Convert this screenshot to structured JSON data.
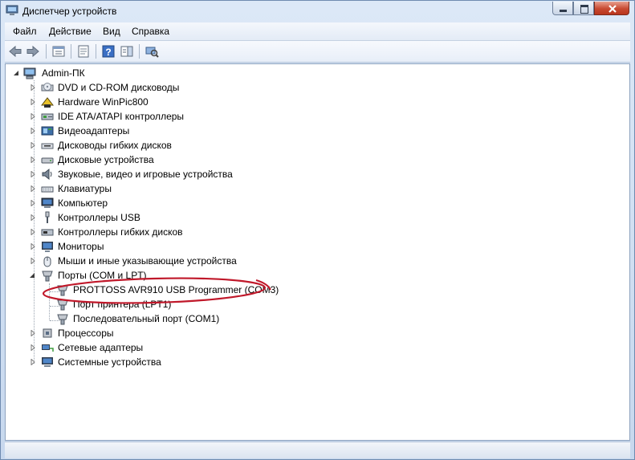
{
  "window": {
    "title": "Диспетчер устройств"
  },
  "menu": [
    "Файл",
    "Действие",
    "Вид",
    "Справка"
  ],
  "toolbar": [
    "back",
    "forward",
    "show-hide-console",
    "properties",
    "help",
    "actions-pane",
    "scan-hardware"
  ],
  "tree": {
    "root": {
      "label": "Admin-ПК",
      "icon": "computer-icon",
      "expanded": true
    },
    "categories": [
      {
        "label": "DVD и CD-ROM дисководы",
        "icon": "dvd-drive-icon"
      },
      {
        "label": "Hardware WinPic800",
        "icon": "chip-programmer-icon"
      },
      {
        "label": "IDE ATA/ATAPI контроллеры",
        "icon": "ide-controller-icon"
      },
      {
        "label": "Видеоадаптеры",
        "icon": "display-adapter-icon"
      },
      {
        "label": "Дисководы гибких дисков",
        "icon": "floppy-drive-icon"
      },
      {
        "label": "Дисковые устройства",
        "icon": "disk-drive-icon"
      },
      {
        "label": "Звуковые, видео и игровые устройства",
        "icon": "speaker-icon"
      },
      {
        "label": "Клавиатуры",
        "icon": "keyboard-icon"
      },
      {
        "label": "Компьютер",
        "icon": "computer-icon"
      },
      {
        "label": "Контроллеры USB",
        "icon": "usb-icon"
      },
      {
        "label": "Контроллеры гибких дисков",
        "icon": "floppy-controller-icon"
      },
      {
        "label": "Мониторы",
        "icon": "monitor-icon"
      },
      {
        "label": "Мыши и иные указывающие устройства",
        "icon": "mouse-icon"
      },
      {
        "label": "Порты (COM и LPT)",
        "icon": "port-icon",
        "expanded": true,
        "children": [
          {
            "label": "PROTTOSS AVR910 USB Programmer (COM3)",
            "icon": "port-icon",
            "highlighted": true
          },
          {
            "label": "Порт принтера (LPT1)",
            "icon": "port-icon"
          },
          {
            "label": "Последовательный порт (COM1)",
            "icon": "port-icon"
          }
        ]
      },
      {
        "label": "Процессоры",
        "icon": "processor-icon"
      },
      {
        "label": "Сетевые адаптеры",
        "icon": "network-adapter-icon"
      },
      {
        "label": "Системные устройства",
        "icon": "system-devices-icon"
      }
    ]
  },
  "colors": {
    "highlight_ellipse": "#c0182a",
    "titlebar": "#c7d8ee",
    "close_button": "#c84a31"
  }
}
